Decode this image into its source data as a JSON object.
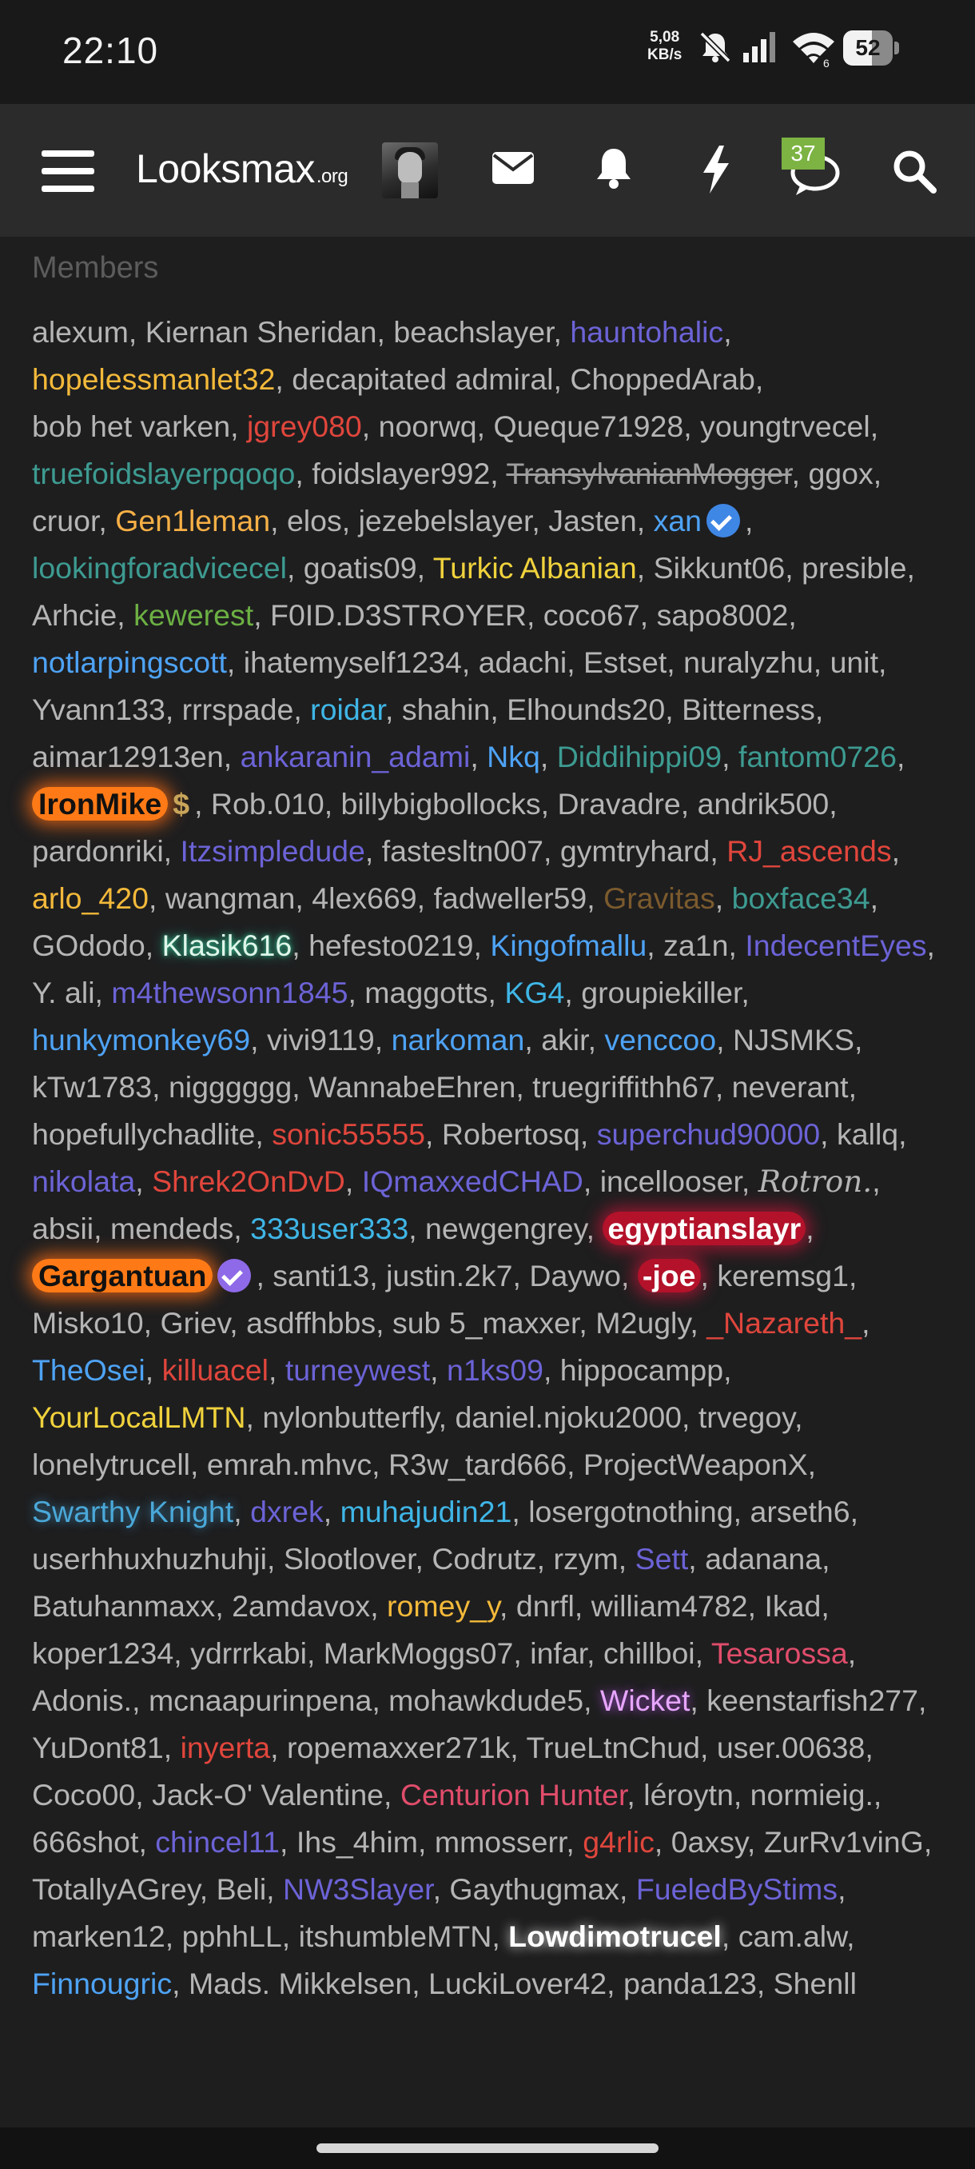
{
  "status_bar": {
    "time": "22:10",
    "net_speed_value": "5,08",
    "net_speed_unit": "KB/s",
    "wifi_badge": "6",
    "battery_level": "52",
    "icons": [
      "mute-icon",
      "signal-icon",
      "wifi-icon",
      "battery-icon"
    ]
  },
  "navbar": {
    "logo_main": "Looksmax",
    "logo_suffix": ".org",
    "conversations_badge": "37",
    "icons": [
      "menu-icon",
      "avatar",
      "envelope-icon",
      "bell-icon",
      "lightning-icon",
      "chat-icon",
      "search-icon"
    ]
  },
  "section_title": "Members",
  "members": [
    {
      "name": "alexum",
      "style": "plain"
    },
    {
      "name": "Kiernan Sheridan",
      "style": "plain"
    },
    {
      "name": "beachslayer",
      "style": "plain"
    },
    {
      "name": "hauntohalic",
      "style": "violet"
    },
    {
      "name": "hopelessmanlet32",
      "style": "orange"
    },
    {
      "name": "decapitated admiral",
      "style": "plain"
    },
    {
      "name": "ChoppedArab",
      "style": "plain"
    },
    {
      "name": "bob het varken",
      "style": "plain"
    },
    {
      "name": "jgrey080",
      "style": "red"
    },
    {
      "name": "noorwq",
      "style": "plain"
    },
    {
      "name": "Queque71928",
      "style": "plain"
    },
    {
      "name": "youngtrvecel",
      "style": "plain"
    },
    {
      "name": "truefoidslayerpqoqo",
      "style": "teal"
    },
    {
      "name": "foidslayer992",
      "style": "plain"
    },
    {
      "name": "TransylvanianMogger",
      "style": "strike"
    },
    {
      "name": "ggox",
      "style": "plain"
    },
    {
      "name": "cruor",
      "style": "plain"
    },
    {
      "name": "Gen1leman",
      "style": "gold"
    },
    {
      "name": "elos",
      "style": "plain"
    },
    {
      "name": "jezebelslayer",
      "style": "plain"
    },
    {
      "name": "Jasten",
      "style": "plain"
    },
    {
      "name": "xan",
      "style": "lblue",
      "badge": "check-blue"
    },
    {
      "name": "lookingforadvicecel",
      "style": "teal"
    },
    {
      "name": "goatis09",
      "style": "plain"
    },
    {
      "name": "Turkic Albanian",
      "style": "yellow"
    },
    {
      "name": "Sikkunt06",
      "style": "plain"
    },
    {
      "name": "presible",
      "style": "plain"
    },
    {
      "name": "Arhcie",
      "style": "plain"
    },
    {
      "name": "kewerest",
      "style": "green"
    },
    {
      "name": "F0ID.D3STROYER",
      "style": "plain"
    },
    {
      "name": "coco67",
      "style": "plain"
    },
    {
      "name": "sapo8002",
      "style": "plain"
    },
    {
      "name": "notlarpingscott",
      "style": "lblue"
    },
    {
      "name": "ihatemyself1234",
      "style": "plain"
    },
    {
      "name": "adachi",
      "style": "plain"
    },
    {
      "name": "Estset",
      "style": "plain"
    },
    {
      "name": "nuralyzhu",
      "style": "plain"
    },
    {
      "name": "unit",
      "style": "plain"
    },
    {
      "name": "Yvann133",
      "style": "plain"
    },
    {
      "name": "rrrspade",
      "style": "plain"
    },
    {
      "name": "roidar",
      "style": "cyan"
    },
    {
      "name": "shahin",
      "style": "plain"
    },
    {
      "name": "Elhounds20",
      "style": "plain"
    },
    {
      "name": "Bitterness",
      "style": "plain"
    },
    {
      "name": "aimar12913en",
      "style": "plain"
    },
    {
      "name": "ankaranin_adami",
      "style": "violet"
    },
    {
      "name": "Nkq",
      "style": "lblue"
    },
    {
      "name": "Diddihippi09",
      "style": "teal"
    },
    {
      "name": "fantom0726",
      "style": "teal"
    },
    {
      "name": "IronMike",
      "style": "glow-orange",
      "badge": "dollar"
    },
    {
      "name": "Rob.010",
      "style": "plain"
    },
    {
      "name": "billybigbollocks",
      "style": "plain"
    },
    {
      "name": "Dravadre",
      "style": "plain"
    },
    {
      "name": "andrik500",
      "style": "plain"
    },
    {
      "name": "pardonriki",
      "style": "plain"
    },
    {
      "name": "Itzsimpledude",
      "style": "violet"
    },
    {
      "name": "fastesltn007",
      "style": "plain"
    },
    {
      "name": "gymtryhard",
      "style": "plain"
    },
    {
      "name": "RJ_ascends",
      "style": "red"
    },
    {
      "name": "arlo_420",
      "style": "orange"
    },
    {
      "name": "wangman",
      "style": "plain"
    },
    {
      "name": "4lex669",
      "style": "plain"
    },
    {
      "name": "fadweller59",
      "style": "plain"
    },
    {
      "name": "Gravitas",
      "style": "brown"
    },
    {
      "name": "boxface34",
      "style": "teal"
    },
    {
      "name": "GOdodo",
      "style": "plain"
    },
    {
      "name": "Klasik616",
      "style": "glow-teal"
    },
    {
      "name": "hefesto0219",
      "style": "plain"
    },
    {
      "name": "Kingofmallu",
      "style": "lblue"
    },
    {
      "name": "za1n",
      "style": "plain"
    },
    {
      "name": "IndecentEyes",
      "style": "violet"
    },
    {
      "name": "Y. ali",
      "style": "plain"
    },
    {
      "name": "m4thewsonn1845",
      "style": "violet"
    },
    {
      "name": "maggotts",
      "style": "plain"
    },
    {
      "name": "KG4",
      "style": "cyan"
    },
    {
      "name": "groupiekiller",
      "style": "plain"
    },
    {
      "name": "hunkymonkey69",
      "style": "lblue"
    },
    {
      "name": "vivi9119",
      "style": "plain"
    },
    {
      "name": "narkoman",
      "style": "lblue"
    },
    {
      "name": "akir",
      "style": "plain"
    },
    {
      "name": "venccoo",
      "style": "lblue"
    },
    {
      "name": "NJSMKS",
      "style": "plain"
    },
    {
      "name": "kTw1783",
      "style": "plain"
    },
    {
      "name": "nigggggg",
      "style": "plain"
    },
    {
      "name": "WannabeEhren",
      "style": "plain"
    },
    {
      "name": "truegriffithh67",
      "style": "plain"
    },
    {
      "name": "neverant",
      "style": "plain"
    },
    {
      "name": "hopefullychadlite",
      "style": "plain"
    },
    {
      "name": "sonic55555",
      "style": "red"
    },
    {
      "name": "Robertosq",
      "style": "plain"
    },
    {
      "name": "superchud90000",
      "style": "violet"
    },
    {
      "name": "kallq",
      "style": "plain"
    },
    {
      "name": "nikolata",
      "style": "violet"
    },
    {
      "name": "Shrek2OnDvD",
      "style": "red"
    },
    {
      "name": "IQmaxxedCHAD",
      "style": "violet"
    },
    {
      "name": "incellooser",
      "style": "plain"
    },
    {
      "name": "Rotron.",
      "style": "goth"
    },
    {
      "name": "absii",
      "style": "plain"
    },
    {
      "name": "mendeds",
      "style": "plain"
    },
    {
      "name": "333user333",
      "style": "cyan"
    },
    {
      "name": "newgengrey",
      "style": "plain"
    },
    {
      "name": "egyptianslayr",
      "style": "glow-red"
    },
    {
      "name": "Gargantuan",
      "style": "glow-orange",
      "badge": "check-purple"
    },
    {
      "name": "santi13",
      "style": "plain"
    },
    {
      "name": "justin.2k7",
      "style": "plain"
    },
    {
      "name": "Daywo",
      "style": "plain"
    },
    {
      "name": "-joe",
      "style": "glow-red"
    },
    {
      "name": "keremsg1",
      "style": "plain"
    },
    {
      "name": "Misko10",
      "style": "plain"
    },
    {
      "name": "Griev",
      "style": "plain"
    },
    {
      "name": "asdffhbbs",
      "style": "plain"
    },
    {
      "name": "sub 5_maxxer",
      "style": "plain"
    },
    {
      "name": "M2ugly",
      "style": "plain"
    },
    {
      "name": "_Nazareth_",
      "style": "red"
    },
    {
      "name": "TheOsei",
      "style": "lblue"
    },
    {
      "name": "killuacel",
      "style": "red"
    },
    {
      "name": "turneywest",
      "style": "violet"
    },
    {
      "name": "n1ks09",
      "style": "violet"
    },
    {
      "name": "hippocampp",
      "style": "plain"
    },
    {
      "name": "YourLocalLMTN",
      "style": "yellow"
    },
    {
      "name": "nylonbutterfly",
      "style": "plain"
    },
    {
      "name": "daniel.njoku2000",
      "style": "plain"
    },
    {
      "name": "trvegoy",
      "style": "plain"
    },
    {
      "name": "lonelytrucell",
      "style": "plain"
    },
    {
      "name": "emrah.mhvc",
      "style": "plain"
    },
    {
      "name": "R3w_tard666",
      "style": "plain"
    },
    {
      "name": "ProjectWeaponX",
      "style": "plain"
    },
    {
      "name": "Swarthy Knight",
      "style": "glow-cyan"
    },
    {
      "name": "dxrek",
      "style": "violet"
    },
    {
      "name": "muhajudin21",
      "style": "cyan"
    },
    {
      "name": "losergotnothing",
      "style": "plain"
    },
    {
      "name": "arseth6",
      "style": "plain"
    },
    {
      "name": "userhhuxhuzhuhji",
      "style": "plain"
    },
    {
      "name": "Slootlover",
      "style": "plain"
    },
    {
      "name": "Codrutz",
      "style": "plain"
    },
    {
      "name": "rzym",
      "style": "plain"
    },
    {
      "name": "Sett",
      "style": "violet"
    },
    {
      "name": "adanana",
      "style": "plain"
    },
    {
      "name": "Batuhanmaxx",
      "style": "plain"
    },
    {
      "name": "2amdavox",
      "style": "plain"
    },
    {
      "name": "romey_y",
      "style": "orange"
    },
    {
      "name": "dnrfl",
      "style": "plain"
    },
    {
      "name": "william4782",
      "style": "plain"
    },
    {
      "name": "Ikad",
      "style": "plain"
    },
    {
      "name": "koper1234",
      "style": "plain"
    },
    {
      "name": "ydrrrkabi",
      "style": "plain"
    },
    {
      "name": "MarkMoggs07",
      "style": "plain"
    },
    {
      "name": "infar",
      "style": "plain"
    },
    {
      "name": "chillboi",
      "style": "plain"
    },
    {
      "name": "Tesarossa",
      "style": "crimson"
    },
    {
      "name": "Adonis.",
      "style": "plain"
    },
    {
      "name": "mcnaapurinpena",
      "style": "plain"
    },
    {
      "name": "mohawkdude5",
      "style": "plain"
    },
    {
      "name": "Wicket",
      "style": "glow-pink"
    },
    {
      "name": "keenstarfish277",
      "style": "plain"
    },
    {
      "name": "YuDont81",
      "style": "plain"
    },
    {
      "name": "inyerta",
      "style": "red"
    },
    {
      "name": "ropemaxxer271k",
      "style": "plain"
    },
    {
      "name": "TrueLtnChud",
      "style": "plain"
    },
    {
      "name": "user.00638",
      "style": "plain"
    },
    {
      "name": "Coco00",
      "style": "plain"
    },
    {
      "name": "Jack-O' Valentine",
      "style": "plain"
    },
    {
      "name": "Centurion Hunter",
      "style": "crimson"
    },
    {
      "name": "léroytn",
      "style": "plain"
    },
    {
      "name": "normieig.",
      "style": "plain"
    },
    {
      "name": "666shot",
      "style": "plain"
    },
    {
      "name": "chincel11",
      "style": "violet"
    },
    {
      "name": "Ihs_4him",
      "style": "plain"
    },
    {
      "name": "mmosserr",
      "style": "plain"
    },
    {
      "name": "g4rlic",
      "style": "red"
    },
    {
      "name": "0axsy",
      "style": "plain"
    },
    {
      "name": "ZurRv1vinG",
      "style": "plain"
    },
    {
      "name": "TotallyAGrey",
      "style": "plain"
    },
    {
      "name": "Beli",
      "style": "plain"
    },
    {
      "name": "NW3Slayer",
      "style": "violet"
    },
    {
      "name": "Gaythugmax",
      "style": "plain"
    },
    {
      "name": "FueledByStims",
      "style": "violet"
    },
    {
      "name": "marken12",
      "style": "plain"
    },
    {
      "name": "pphhLL",
      "style": "plain"
    },
    {
      "name": "itshumbleMTN",
      "style": "plain"
    },
    {
      "name": "Lowdimotrucel",
      "style": "glow-white"
    },
    {
      "name": "cam.alw",
      "style": "plain"
    },
    {
      "name": "Finnougric",
      "style": "lblue"
    },
    {
      "name": "Mads. Mikkelsen",
      "style": "plain"
    },
    {
      "name": "LuckiLover42",
      "style": "plain"
    },
    {
      "name": "panda123",
      "style": "plain"
    },
    {
      "name": "Shenll",
      "style": "plain"
    }
  ],
  "colors": {
    "background": "#1e1e1f",
    "navbar": "#2b2b2c",
    "badge": "#7cb342"
  }
}
